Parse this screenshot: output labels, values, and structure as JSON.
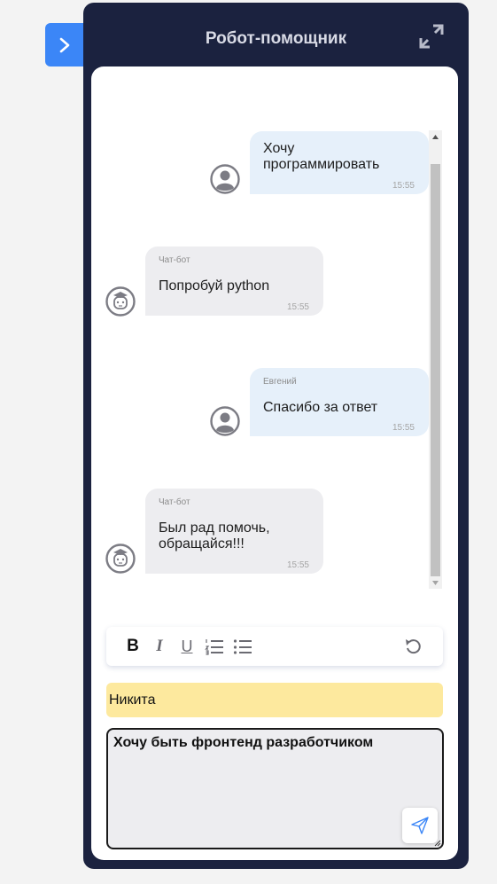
{
  "sidebar_toggle": {
    "icon": "chevron-right-icon"
  },
  "header": {
    "title": "Робот-помощник",
    "expand_icon": "expand-icon"
  },
  "messages": [
    {
      "sender": "user",
      "name": "",
      "text_lines": [
        "Хочу",
        "программировать"
      ],
      "time": "15:55"
    },
    {
      "sender": "bot",
      "name": "Чат-бот",
      "text_lines": [
        "Попробуй python"
      ],
      "time": "15:55"
    },
    {
      "sender": "user",
      "name": "Евгений",
      "text_lines": [
        "Спасибо за ответ"
      ],
      "time": "15:55"
    },
    {
      "sender": "bot",
      "name": "Чат-бот",
      "text_lines": [
        "Был рад помочь,",
        "обращайся!!!"
      ],
      "time": "15:55"
    }
  ],
  "toolbar": {
    "bold_label": "B",
    "italic_label": "I",
    "underline_label": "U",
    "icons": [
      "bold-icon",
      "italic-icon",
      "underline-icon",
      "ordered-list-icon",
      "bullet-list-icon",
      "undo-icon"
    ]
  },
  "recipient": {
    "value": "Никита"
  },
  "compose": {
    "value": "Хочу быть фронтенд разработчиком",
    "send_icon": "send-icon"
  },
  "colors": {
    "panel_bg": "#1b223f",
    "accent": "#3b86f7",
    "user_bubble": "#e6f0fa",
    "bot_bubble": "#ededf0",
    "recipient_bg": "#fde99e"
  }
}
